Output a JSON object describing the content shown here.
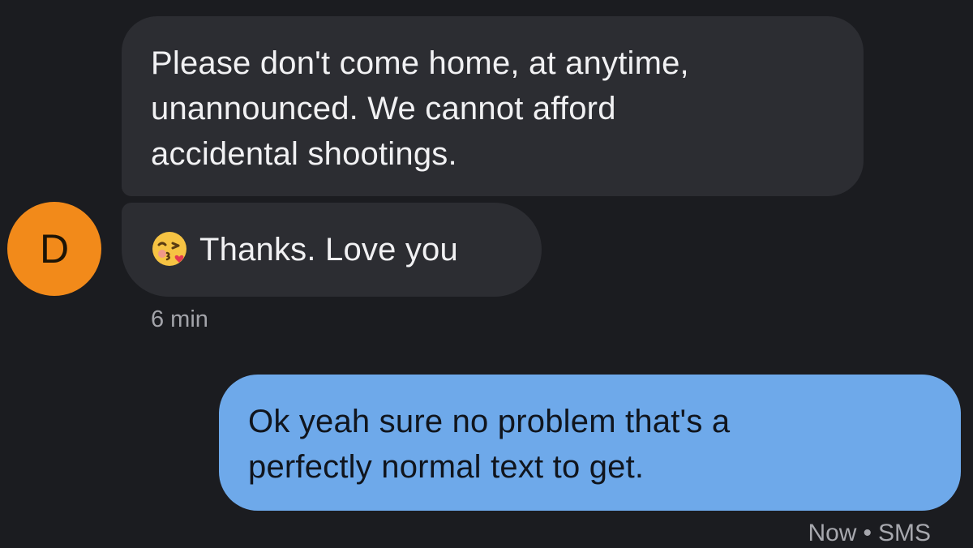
{
  "conversation": {
    "contact_initial": "D",
    "messages": [
      {
        "lines": [
          "Please don't come home, at anytime,",
          "unannounced. We cannot afford",
          "accidental shootings."
        ]
      },
      {
        "emoji": "face-blowing-a-kiss",
        "text": "Thanks. Love you"
      }
    ],
    "timestamp": "6 min"
  },
  "reply": {
    "lines": [
      "Ok yeah sure no problem that's a",
      "perfectly normal text to get."
    ],
    "status_time": "Now",
    "separator": "•",
    "status_type": "SMS"
  },
  "colors": {
    "background": "#1b1c20",
    "incoming_bubble": "#2c2d32",
    "outgoing_bubble": "#6ea9ea",
    "avatar": "#f28a1a"
  }
}
